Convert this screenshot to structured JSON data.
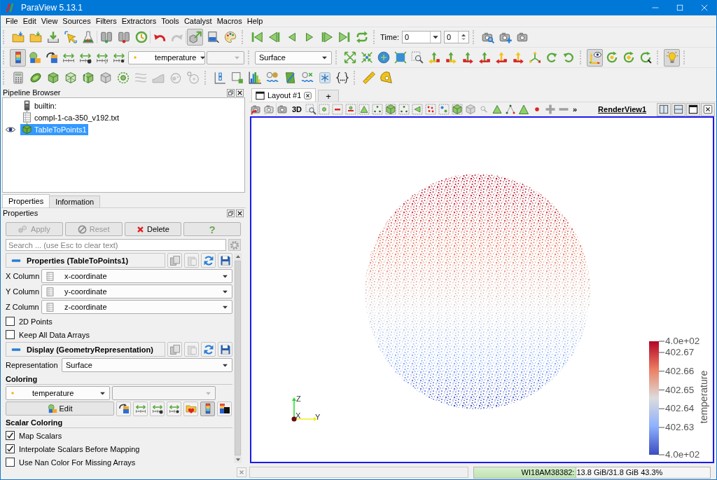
{
  "window": {
    "title": "ParaView 5.13.1"
  },
  "menu": [
    "File",
    "Edit",
    "View",
    "Sources",
    "Filters",
    "Extractors",
    "Tools",
    "Catalyst",
    "Macros",
    "Help"
  ],
  "toolbar_toggles": {
    "interact": {
      "checked": true
    },
    "color_legend": {
      "checked": true
    },
    "orientation_axes": {
      "checked": true
    },
    "light_kit": {
      "checked": true
    }
  },
  "time": {
    "label": "Time:",
    "value": "0",
    "index": "0"
  },
  "active_variable": {
    "value": "temperature"
  },
  "active_component": {
    "disabled": true
  },
  "active_representation": {
    "value": "Surface"
  },
  "pipeline_browser": {
    "title": "Pipeline Browser",
    "items": [
      {
        "kind": "server",
        "label": "builtin:",
        "selected": false,
        "visible": false
      },
      {
        "kind": "table",
        "label": "compl-1-ca-350_v192.txt",
        "selected": false,
        "visible": false
      },
      {
        "kind": "filter",
        "label": "TableToPoints1",
        "selected": true,
        "visible": true
      }
    ]
  },
  "panel_tabs": [
    {
      "label": "Properties",
      "selected": true
    },
    {
      "label": "Information",
      "selected": false
    }
  ],
  "properties": {
    "title": "Properties",
    "actions": [
      {
        "kind": "apply",
        "label": "Apply",
        "disabled": true
      },
      {
        "kind": "reset",
        "label": "Reset",
        "disabled": true
      },
      {
        "kind": "delete",
        "label": "Delete",
        "disabled": false
      },
      {
        "kind": "help",
        "label": "?",
        "disabled": false
      }
    ],
    "search": {
      "placeholder": "Search ... (use Esc to clear text)"
    },
    "source_section": {
      "title": "Properties (TableToPoints1)",
      "expanded": true,
      "columns": [
        {
          "label": "X Column",
          "value": "x-coordinate"
        },
        {
          "label": "Y Column",
          "value": "y-coordinate"
        },
        {
          "label": "Z Column",
          "value": "z-coordinate"
        }
      ],
      "options": [
        {
          "label": "2D Points",
          "checked": false
        },
        {
          "label": "Keep All Data Arrays",
          "checked": false
        }
      ]
    },
    "display_section": {
      "title": "Display (GeometryRepresentation)",
      "expanded": true,
      "representation": {
        "label": "Representation",
        "value": "Surface"
      },
      "coloring": {
        "title": "Coloring",
        "variable": "temperature",
        "component": {
          "disabled": true
        },
        "edit": "Edit",
        "legend_toggle": {
          "checked": true
        }
      },
      "scalar_coloring": {
        "title": "Scalar Coloring",
        "options": [
          {
            "label": "Map Scalars",
            "checked": true
          },
          {
            "label": "Interpolate Scalars Before Mapping",
            "checked": true
          },
          {
            "label": "Use Nan Color For Missing Arrays",
            "checked": false
          }
        ]
      }
    }
  },
  "layout_tabs": [
    {
      "kind": "layout",
      "label": "Layout #1",
      "selected": true
    },
    {
      "kind": "add",
      "label": "+",
      "selected": false
    }
  ],
  "render_toolbar": {
    "mode": "3D",
    "overflow": "»",
    "view_name": "RenderView1"
  },
  "render_view": {
    "legend": {
      "title": "temperature",
      "labels": [
        "4.0e+02",
        "402.67",
        "402.66",
        "402.65",
        "402.64",
        "402.63",
        "4.0e+02"
      ]
    },
    "axes": {
      "z": "Z",
      "x": "X",
      "y": "Y"
    }
  },
  "status_bar": {
    "memory": {
      "text": "WI18AM38382: 13.8 GiB/31.8 GiB 43.3%",
      "level": 0.433
    }
  }
}
